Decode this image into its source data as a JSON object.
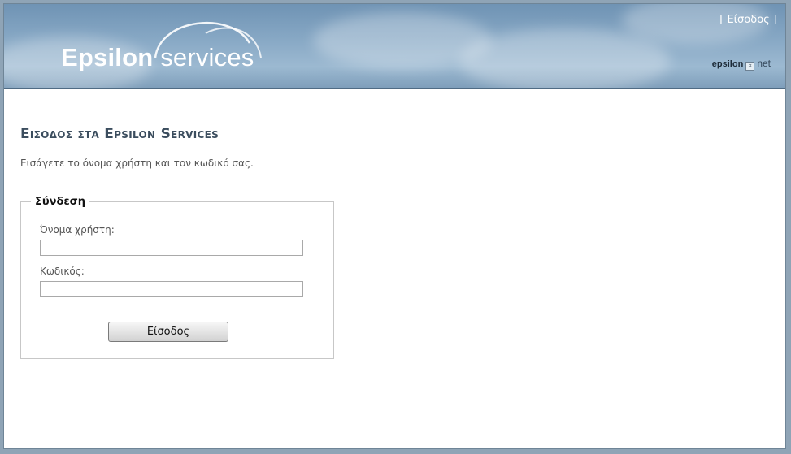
{
  "header": {
    "logo_primary": "Epsilon",
    "logo_secondary": "services",
    "login_link_prefix": "[ ",
    "login_link": "Είσοδος",
    "login_link_suffix": " ]",
    "brand_part1": "epsilon",
    "brand_part2": "net"
  },
  "main": {
    "title": "Εισοδος στα Epsilon Services",
    "intro": "Εισάγετε το όνομα χρήστη και τον κωδικό σας."
  },
  "login_form": {
    "legend": "Σύνδεση",
    "username_label": "Όνομα χρήστη:",
    "username_value": "",
    "password_label": "Κωδικός:",
    "password_value": "",
    "submit_label": "Είσοδος"
  },
  "colors": {
    "header_blue": "#86a7c4",
    "title_text": "#3b4d5e",
    "body_text": "#555555",
    "border": "#c7c7c7"
  }
}
